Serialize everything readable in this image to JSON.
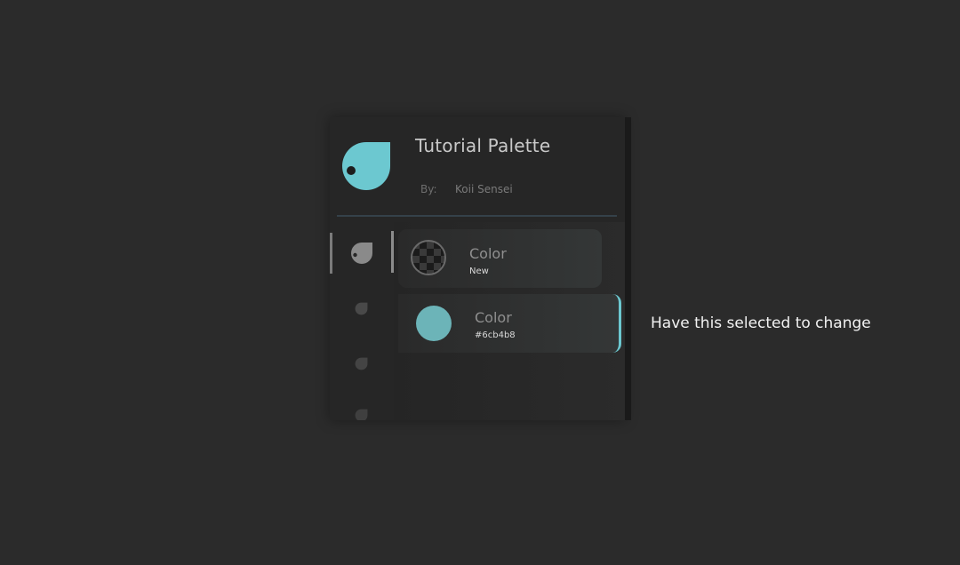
{
  "palette": {
    "title": "Tutorial Palette",
    "by_label": "By:",
    "author": "Koii Sensei",
    "logo_icon": "droplet-logo-icon",
    "accent_color": "#6cc8d0"
  },
  "rail": {
    "icons": [
      "droplet-icon",
      "droplet-icon",
      "droplet-icon",
      "droplet-icon"
    ]
  },
  "colors": [
    {
      "label": "Color",
      "value": "New",
      "swatch": "transparent-checker",
      "selected": false
    },
    {
      "label": "Color",
      "value": "#6cb4b8",
      "swatch": "#6cb4b8",
      "selected": true
    }
  ],
  "annotation": "Have this selected to change"
}
